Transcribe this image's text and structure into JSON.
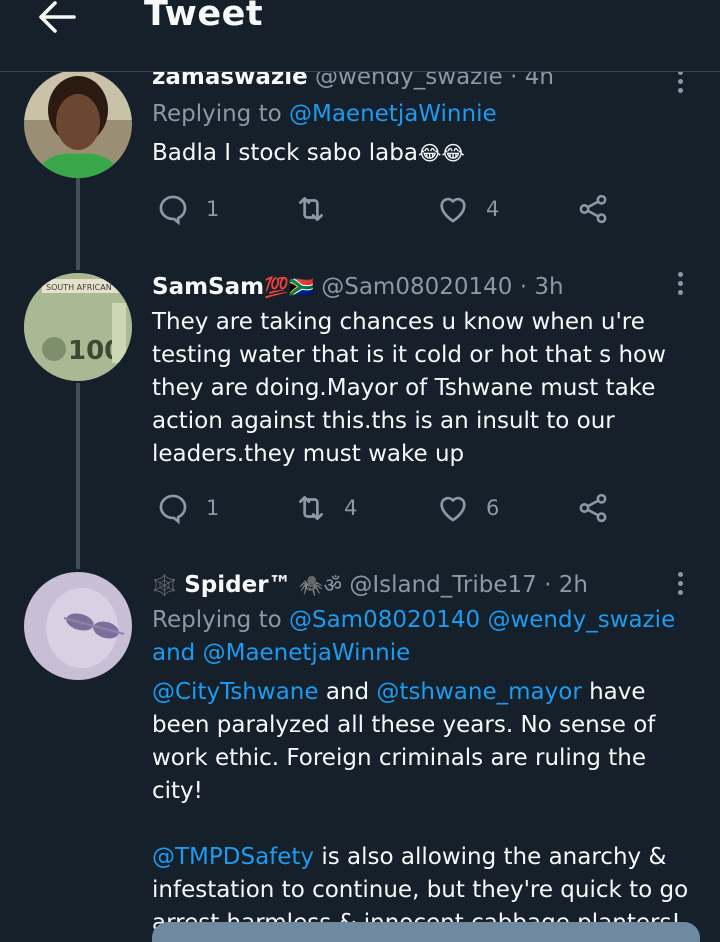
{
  "header": {
    "title": "Tweet"
  },
  "tweets": [
    {
      "name": "zamaswazie",
      "handle": "@wendy_swazie",
      "sep": " · ",
      "time": "4h",
      "replying_prefix": "Replying to ",
      "replying_to": "@MaenetjaWinnie",
      "text": "Badla I stock sabo laba",
      "text_emoji": "😂😂",
      "replies": "1",
      "retweets": "",
      "likes": "4"
    },
    {
      "name": "SamSam",
      "name_badges": "💯🇿🇦",
      "handle": "@Sam08020140",
      "sep": " · ",
      "time": "3h",
      "text": "They are taking chances u know when u're testing water that is it cold or hot that s how they are doing.Mayor of Tshwane must take action against this.ths is an insult to our leaders.they must wake up",
      "replies": "1",
      "retweets": "4",
      "likes": "6"
    },
    {
      "name_prefix": "🕸️",
      "name": "Spider™",
      "name_badges": "🕷️ॐ",
      "handle": "@Island_Tribe17",
      "sep": " · ",
      "time": "2h",
      "replying_prefix": "Replying to ",
      "replying_to_1": "@Sam08020140",
      "replying_to_2": "@wendy_swazie",
      "replying_and": "and",
      "replying_to_3": "@MaenetjaWinnie",
      "p1_mention_1": "@CityTshwane",
      "p1_and": " and ",
      "p1_mention_2": "@tshwane_mayor",
      "p1_rest": " have been paralyzed all these years. No sense of work ethic. Foreign criminals are ruling the city!",
      "p2_mention": "@TMPDSafety",
      "p2_rest": " is also allowing the anarchy & infestation to continue, but they're quick to go arrest harmless & innocent cabbage planters!"
    }
  ],
  "icons": {
    "back": "arrow-left-icon",
    "more": "more-vertical-icon",
    "reply": "reply-icon",
    "retweet": "retweet-icon",
    "like": "heart-icon",
    "share": "share-icon"
  },
  "colors": {
    "background": "#15202b",
    "text": "#f7f9f9",
    "secondary": "#8b98a5",
    "mention": "#1d9bf0",
    "divider": "#38444d"
  }
}
